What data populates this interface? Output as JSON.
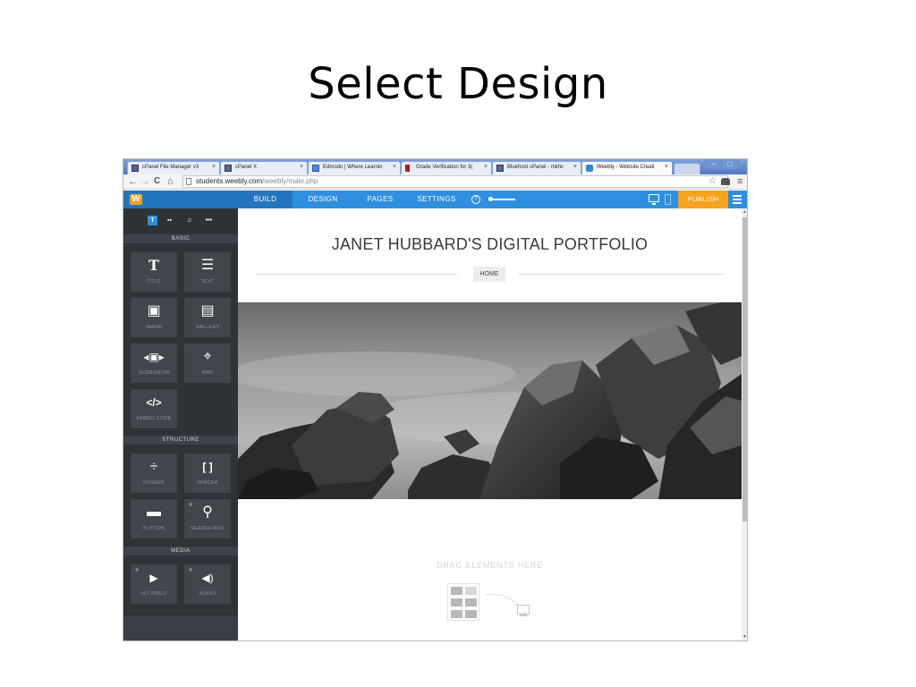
{
  "slide": {
    "title": "Select Design"
  },
  "browser": {
    "tabs": [
      {
        "label": "cPanel File Manager v3",
        "close": "×"
      },
      {
        "label": "cPanel X",
        "close": "×"
      },
      {
        "label": "Edmodo | Where Learnin",
        "close": "×"
      },
      {
        "label": "Grade Verification for 3(",
        "close": "×"
      },
      {
        "label": "Bluehost cPanel - mkhc",
        "close": "×"
      },
      {
        "label": "Weebly - Website Creati",
        "close": "×"
      }
    ],
    "window_controls": {
      "minimize": "–",
      "maximize": "□",
      "close": "✕"
    },
    "nav": {
      "back": "←",
      "forward": "→",
      "reload": "C",
      "home": "⌂"
    },
    "url_host": "students.weebly.com",
    "url_path": "/weebly/main.php",
    "bookmark_star": "☆",
    "menu": "≡"
  },
  "weebly": {
    "logo": "W",
    "tabs": [
      "BUILD",
      "DESIGN",
      "PAGES",
      "SETTINGS"
    ],
    "help": "?",
    "publish": "PUBLISH"
  },
  "sidebar": {
    "categories": [
      "T",
      "▪▪",
      "♫",
      "•••"
    ],
    "sections": [
      {
        "header": "BASIC"
      },
      {
        "header": "STRUCTURE"
      },
      {
        "header": "MEDIA"
      }
    ],
    "elements": [
      {
        "icon": "T",
        "label": "TITLE"
      },
      {
        "icon": "☰",
        "label": "TEXT"
      },
      {
        "icon": "▣",
        "label": "IMAGE"
      },
      {
        "icon": "▤",
        "label": "GALLERY"
      },
      {
        "icon": "◂▣▸",
        "label": "SLIDESHOW"
      },
      {
        "icon": "⌖",
        "label": "MAP"
      },
      {
        "icon": "</>",
        "label": "EMBED CODE"
      },
      {
        "icon": "÷",
        "label": "DIVIDER"
      },
      {
        "icon": "[ ]",
        "label": "SPACER"
      },
      {
        "icon": "▬",
        "label": "BUTTON"
      },
      {
        "icon": "⚲",
        "label": "SEARCH BOX",
        "premium": "★"
      },
      {
        "icon": "▶",
        "label": "HD VIDEO",
        "premium": "★"
      },
      {
        "icon": "◀)",
        "label": "AUDIO",
        "premium": "★"
      }
    ]
  },
  "canvas": {
    "site_title": "JANET HUBBARD'S DIGITAL PORTFOLIO",
    "nav_home": "HOME",
    "drag_text": "DRAG ELEMENTS HERE"
  },
  "colors": {
    "weebly_blue": "#2f8fde",
    "publish_orange": "#f6a31e",
    "sidebar_dark": "#2e3338"
  }
}
